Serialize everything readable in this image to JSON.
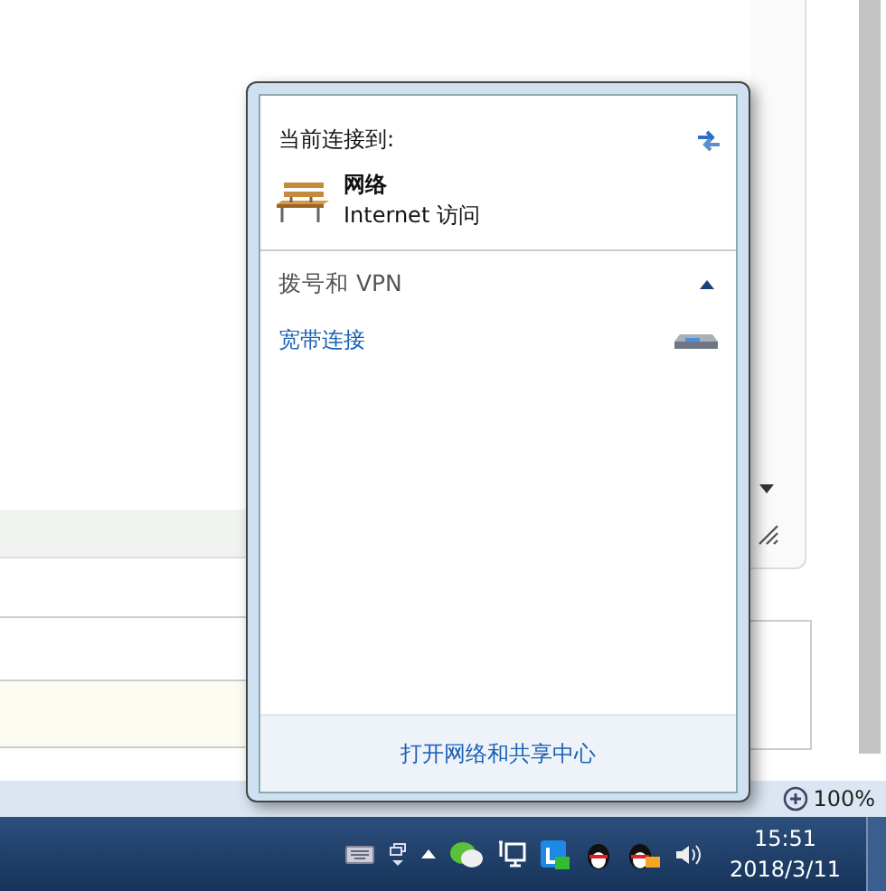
{
  "status_bar": {
    "zoom": "100%"
  },
  "popup": {
    "heading": "当前连接到:",
    "connections": [
      {
        "name": "网络",
        "access": "Internet 访问"
      }
    ],
    "sections": [
      {
        "title": "拨号和 VPN",
        "expanded": true,
        "items": [
          {
            "name": "宽带连接"
          }
        ]
      }
    ],
    "footer_link": "打开网络和共享中心"
  },
  "taskbar": {
    "time": "15:51",
    "date": "2018/3/11"
  }
}
